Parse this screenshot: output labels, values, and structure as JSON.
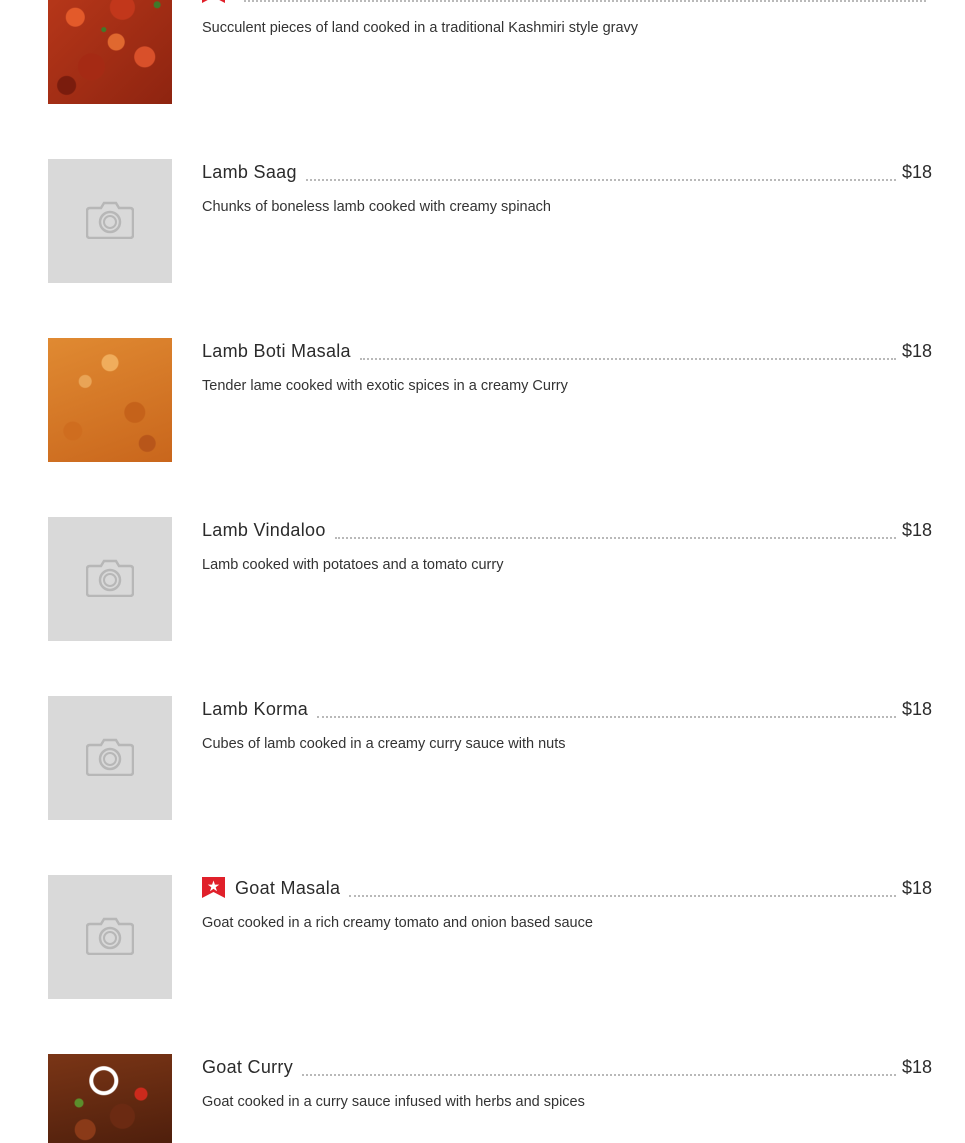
{
  "menu": {
    "items": [
      {
        "name": "",
        "price": "",
        "description": "Succulent pieces of land cooked in a traditional Kashmiri style gravy",
        "image": "curry-photo",
        "featured": true
      },
      {
        "name": "Lamb Saag",
        "price": "$18",
        "description": "Chunks of boneless lamb cooked with creamy spinach",
        "image": "camera-placeholder-icon",
        "featured": false
      },
      {
        "name": "Lamb Boti Masala",
        "price": "$18",
        "description": "Tender lame cooked with exotic spices in a creamy Curry",
        "image": "masala-photo",
        "featured": false
      },
      {
        "name": "Lamb Vindaloo",
        "price": "$18",
        "description": "Lamb cooked with potatoes and a tomato curry",
        "image": "camera-placeholder-icon",
        "featured": false
      },
      {
        "name": "Lamb Korma",
        "price": "$18",
        "description": "Cubes of lamb cooked in a creamy curry sauce with nuts",
        "image": "camera-placeholder-icon",
        "featured": false
      },
      {
        "name": "Goat Masala",
        "price": "$18",
        "description": "Goat cooked in a rich creamy tomato and onion based sauce",
        "image": "camera-placeholder-icon",
        "featured": true
      },
      {
        "name": "Goat Curry",
        "price": "$18",
        "description": "Goat cooked in a curry sauce infused with herbs and spices",
        "image": "goat-curry-photo",
        "featured": false
      }
    ]
  },
  "colors": {
    "featured_badge": "#e0202a",
    "placeholder_bg": "#d9d9d9",
    "leader_dots": "#b9b9b9",
    "text": "#2b2b2b"
  }
}
